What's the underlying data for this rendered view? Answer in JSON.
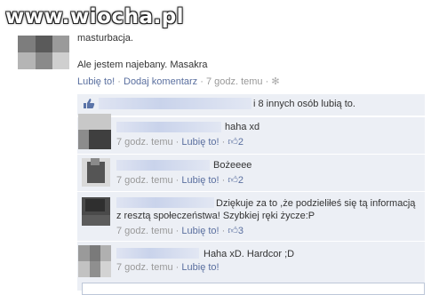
{
  "watermark": "www.wiocha.pl",
  "post": {
    "line1": "masturbacja.",
    "line2": "Ale jestem najebany. Masakra",
    "actions": {
      "like": "Lubię to!",
      "dot": "·",
      "comment": "Dodaj komentarz",
      "time": "7 godz. temu",
      "privacy_icon": "gear-icon"
    }
  },
  "likes": {
    "text": "i 8 innych osób lubią to.",
    "icon": "thumbs-up-icon"
  },
  "comments": [
    {
      "text": "haha xd",
      "time": "7 godz. temu",
      "like": "Lubię to!",
      "like_count": "2"
    },
    {
      "text": "Bożeeee",
      "time": "7 godz. temu",
      "like": "Lubię to!",
      "like_count": "2"
    },
    {
      "text_line1": "Dziękuje za to ,że podzieliłeś się tą informacją",
      "text_line2": "z resztą społeczeństwa! Szybkiej ręki życze:P",
      "time": "7 godz. temu",
      "like": "Lubię to!",
      "like_count": "3"
    },
    {
      "text": "Haha xD. Hardcor ;D",
      "time": "7 godz. temu",
      "like": "Lubię to!"
    }
  ],
  "colors": {
    "link": "#5a6f9f",
    "panel": "#eceff5",
    "meta": "#999999"
  }
}
